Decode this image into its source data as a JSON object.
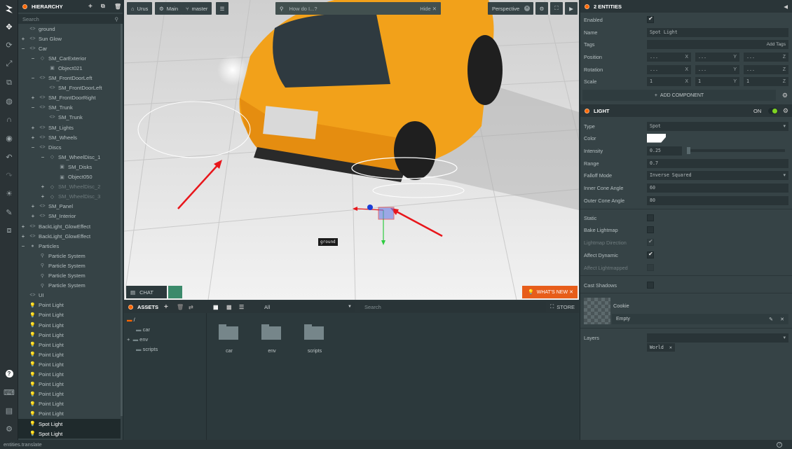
{
  "toolbar": {
    "icons": [
      "playcanvas-logo-icon",
      "move-icon",
      "rotate-icon",
      "scale-icon",
      "resize-icon",
      "globe-icon",
      "magnet-icon",
      "eye-icon",
      "undo-icon",
      "redo-icon",
      "light-icon",
      "edit-icon",
      "code-icon",
      "help-icon",
      "keyboard-icon",
      "chat-icon",
      "settings-icon"
    ]
  },
  "hierarchy": {
    "title": "HIERARCHY",
    "search_placeholder": "Search",
    "items": [
      {
        "label": "ground",
        "indent": 0,
        "exp": "",
        "ico": "<>"
      },
      {
        "label": "Sun Glow",
        "indent": 0,
        "exp": "+",
        "ico": "<>"
      },
      {
        "label": "Car",
        "indent": 0,
        "exp": "−",
        "ico": "<>"
      },
      {
        "label": "SM_CarExterior",
        "indent": 1,
        "exp": "−",
        "ico": "◇"
      },
      {
        "label": "Object021",
        "indent": 2,
        "exp": "",
        "ico": "▣"
      },
      {
        "label": "SM_FrontDoorLeft",
        "indent": 1,
        "exp": "−",
        "ico": "<>"
      },
      {
        "label": "SM_FrontDoorLeft",
        "indent": 2,
        "exp": "",
        "ico": "<>"
      },
      {
        "label": "SM_FrontDoorRight",
        "indent": 1,
        "exp": "+",
        "ico": "<>"
      },
      {
        "label": "SM_Trunk",
        "indent": 1,
        "exp": "−",
        "ico": "<>"
      },
      {
        "label": "SM_Trunk",
        "indent": 2,
        "exp": "",
        "ico": "<>"
      },
      {
        "label": "SM_Lights",
        "indent": 1,
        "exp": "+",
        "ico": "<>"
      },
      {
        "label": "SM_Wheels",
        "indent": 1,
        "exp": "+",
        "ico": "<>"
      },
      {
        "label": "Discs",
        "indent": 1,
        "exp": "−",
        "ico": "<>"
      },
      {
        "label": "SM_WheelDisc_1",
        "indent": 2,
        "exp": "−",
        "ico": "◇"
      },
      {
        "label": "SM_Disks",
        "indent": 3,
        "exp": "",
        "ico": "▣"
      },
      {
        "label": "Object050",
        "indent": 3,
        "exp": "",
        "ico": "▣"
      },
      {
        "label": "SM_WheelDisc_2",
        "indent": 2,
        "exp": "+",
        "ico": "◇",
        "dim": true
      },
      {
        "label": "SM_WheelDisc_3",
        "indent": 2,
        "exp": "+",
        "ico": "◇",
        "dim": true
      },
      {
        "label": "SM_Panel",
        "indent": 1,
        "exp": "+",
        "ico": "<>"
      },
      {
        "label": "SM_Interior",
        "indent": 1,
        "exp": "+",
        "ico": "<>"
      },
      {
        "label": "BackLight_GlowEffect",
        "indent": 0,
        "exp": "+",
        "ico": "<>"
      },
      {
        "label": "BackLight_GlowEffect",
        "indent": 0,
        "exp": "+",
        "ico": "<>"
      },
      {
        "label": "Particles",
        "indent": 0,
        "exp": "−",
        "ico": "●"
      },
      {
        "label": "Particle System",
        "indent": 1,
        "exp": "",
        "ico": "⚲"
      },
      {
        "label": "Particle System",
        "indent": 1,
        "exp": "",
        "ico": "⚲"
      },
      {
        "label": "Particle System",
        "indent": 1,
        "exp": "",
        "ico": "⚲"
      },
      {
        "label": "Particle System",
        "indent": 1,
        "exp": "",
        "ico": "⚲"
      },
      {
        "label": "UI",
        "indent": 0,
        "exp": "",
        "ico": "<>"
      },
      {
        "label": "Point Light",
        "indent": 0,
        "exp": "",
        "ico": "💡"
      },
      {
        "label": "Point Light",
        "indent": 0,
        "exp": "",
        "ico": "💡"
      },
      {
        "label": "Point Light",
        "indent": 0,
        "exp": "",
        "ico": "💡"
      },
      {
        "label": "Point Light",
        "indent": 0,
        "exp": "",
        "ico": "💡"
      },
      {
        "label": "Point Light",
        "indent": 0,
        "exp": "",
        "ico": "💡"
      },
      {
        "label": "Point Light",
        "indent": 0,
        "exp": "",
        "ico": "💡"
      },
      {
        "label": "Point Light",
        "indent": 0,
        "exp": "",
        "ico": "💡"
      },
      {
        "label": "Point Light",
        "indent": 0,
        "exp": "",
        "ico": "💡"
      },
      {
        "label": "Point Light",
        "indent": 0,
        "exp": "",
        "ico": "💡"
      },
      {
        "label": "Point Light",
        "indent": 0,
        "exp": "",
        "ico": "💡"
      },
      {
        "label": "Point Light",
        "indent": 0,
        "exp": "",
        "ico": "💡"
      },
      {
        "label": "Point Light",
        "indent": 0,
        "exp": "",
        "ico": "💡"
      },
      {
        "label": "Spot Light",
        "indent": 0,
        "exp": "",
        "ico": "💡",
        "sel": true
      },
      {
        "label": "Spot Light",
        "indent": 0,
        "exp": "",
        "ico": "💡",
        "sel": true
      }
    ]
  },
  "viewport": {
    "project": "Urus",
    "scene": "Main",
    "branch": "master",
    "search_placeholder": "How do I...?",
    "hide_label": "Hide",
    "camera": "Perspective",
    "ground_label": "ground",
    "chat_label": "CHAT",
    "whats_new_label": "WHAT'S NEW"
  },
  "assets": {
    "title": "ASSETS",
    "filter": "All",
    "search_placeholder": "Search",
    "store_label": "STORE",
    "root": "/",
    "tree": [
      "car",
      "env",
      "scripts"
    ],
    "folders": [
      "car",
      "env",
      "scripts"
    ]
  },
  "inspector": {
    "title": "2 ENTITIES",
    "enabled_label": "Enabled",
    "name_label": "Name",
    "name_value": "Spot Light",
    "tags_label": "Tags",
    "add_tags": "Add Tags",
    "position_label": "Position",
    "position": [
      "...",
      "...",
      "..."
    ],
    "rotation_label": "Rotation",
    "rotation": [
      "...",
      "...",
      "..."
    ],
    "scale_label": "Scale",
    "scale": [
      "1",
      "1",
      "1"
    ],
    "axis": [
      "X",
      "Y",
      "Z"
    ],
    "add_component": "ADD COMPONENT",
    "light": {
      "title": "LIGHT",
      "on_label": "ON",
      "type_label": "Type",
      "type_value": "Spot",
      "color_label": "Color",
      "intensity_label": "Intensity",
      "intensity_value": "0.25",
      "intensity_fraction": 0.0,
      "range_label": "Range",
      "range_value": "0.7",
      "falloff_label": "Falloff Mode",
      "falloff_value": "Inverse Squared",
      "inner_label": "Inner Cone Angle",
      "inner_value": "60",
      "outer_label": "Outer Cone Angle",
      "outer_value": "80",
      "static_label": "Static",
      "bake_label": "Bake Lightmap",
      "lightmap_dir_label": "Lightmap Direction",
      "affect_dynamic_label": "Affect Dynamic",
      "affect_lightmapped_label": "Affect Lightmapped",
      "cast_shadows_label": "Cast Shadows",
      "cookie_label": "Cookie",
      "cookie_value": "Empty",
      "layers_label": "Layers",
      "layer_tag": "World"
    }
  },
  "status": {
    "text": "entities.translate"
  },
  "colors": {
    "accent": "#ff6600",
    "panel": "#364346",
    "dark": "#293437",
    "on_green": "#7ed321",
    "car": "#f2a11a"
  }
}
